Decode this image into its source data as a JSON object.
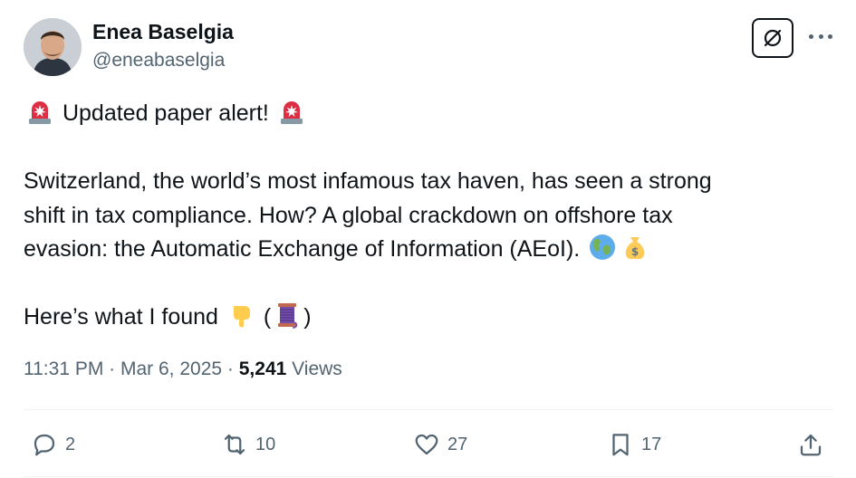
{
  "author": {
    "name": "Enea Baselgia",
    "handle": "@eneabaselgia"
  },
  "tweet": {
    "line1": "Updated paper alert!",
    "para2_line1": "Switzerland, the world’s most infamous tax haven, has seen a strong",
    "para2_line2": "shift in tax compliance. How? A global crackdown on offshore tax",
    "para2_line3": "evasion: the Automatic Exchange of Information (AEoI).",
    "para3_a": "Here’s what I found",
    "para3_open": "(",
    "para3_close": ")",
    "emojis": [
      "rotating-light",
      "rotating-light",
      "globe",
      "money-bag",
      "pointing-down",
      "thread"
    ]
  },
  "meta": {
    "time": "11:31 PM",
    "sep1": " · ",
    "date": "Mar 6, 2025",
    "sep2": " · ",
    "views_count": "5,241",
    "views_label": "Views"
  },
  "actions": {
    "replies": "2",
    "reposts": "10",
    "likes": "27",
    "bookmarks": "17"
  },
  "colors": {
    "text": "#0f1419",
    "secondary": "#536471",
    "divider": "#eff3f4"
  }
}
